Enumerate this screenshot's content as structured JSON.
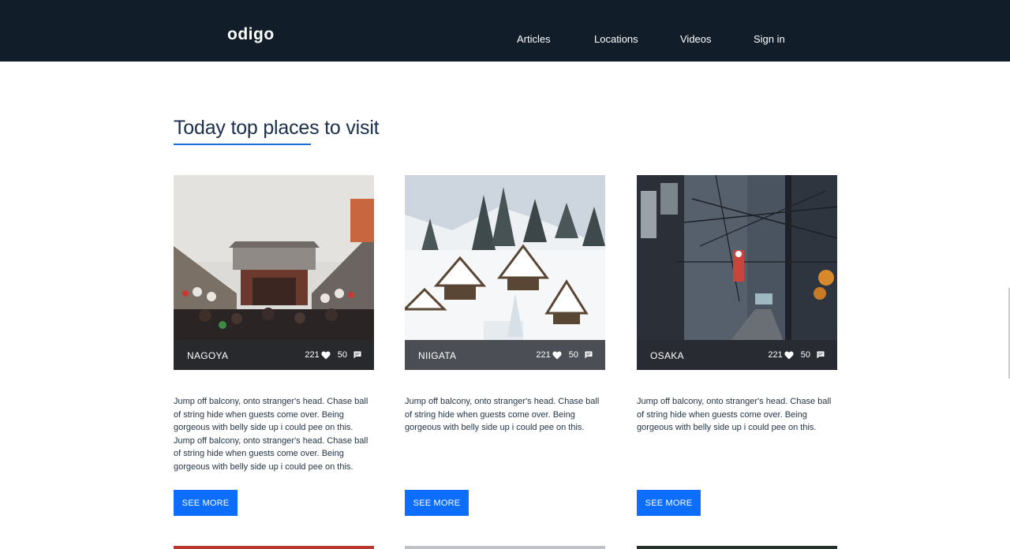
{
  "brand": {
    "name": "odigo"
  },
  "nav": {
    "items": [
      {
        "label": "Articles"
      },
      {
        "label": "Locations"
      },
      {
        "label": "Videos"
      },
      {
        "label": "Sign in"
      }
    ]
  },
  "section": {
    "title": "Today top places to visit"
  },
  "cards": [
    {
      "city": "NAGOYA",
      "likes": "221",
      "comments": "50",
      "description": "Jump off balcony, onto stranger's head. Chase ball of string hide when guests come over. Being gorgeous with belly side up i could pee on this. Jump off balcony, onto stranger's head. Chase ball of string hide when guests come over. Being gorgeous with belly side up i could pee on this.",
      "button": "SEE MORE",
      "image": "temple-market-street"
    },
    {
      "city": "NIIGATA",
      "likes": "221",
      "comments": "50",
      "description": "Jump off balcony, onto stranger's head. Chase ball of string hide when guests come over. Being gorgeous with belly side up i could pee on this.",
      "button": "SEE MORE",
      "image": "snowy-village"
    },
    {
      "city": "OSAKA",
      "likes": "221",
      "comments": "50",
      "description": "Jump off balcony, onto stranger's head. Chase ball of string hide when guests come over. Being gorgeous with belly side up i could pee on this.",
      "button": "SEE MORE",
      "image": "city-alley-power-lines"
    }
  ],
  "icons": {
    "likes": "heart-icon",
    "comments": "comment-icon"
  },
  "colors": {
    "header_bg": "#111d29",
    "accent": "#0d6efd",
    "underline": "#1a6cd6",
    "title": "#1b2f4c",
    "overlay": "#282a30"
  }
}
